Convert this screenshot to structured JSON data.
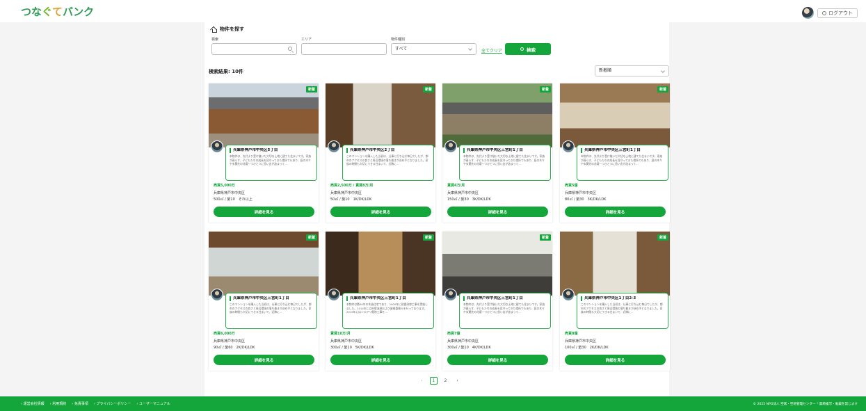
{
  "header": {
    "logo_chars": [
      "つ",
      "な",
      "ぐ",
      "て",
      "バ",
      "ン",
      "ク"
    ],
    "logo_colors": [
      "#2f9d55",
      "#2f9d55",
      "#74b72e",
      "#e0a43b",
      "#2f9d55",
      "#2f9d55",
      "#2f9d55"
    ],
    "logout_label": "ログアウト"
  },
  "search": {
    "title": "物件を探す",
    "keyword_label": "検索",
    "area_label": "エリア",
    "type_label": "物件種別",
    "type_value": "すべて",
    "clear_label": "全てクリア",
    "search_button": "検索"
  },
  "results": {
    "count_label": "検索結果: 10件",
    "sort_value": "新着順"
  },
  "cards": [
    {
      "badge": "新着",
      "address": "兵庫県神戸市中央区5丁目",
      "description": "本物件は、先代より受け継いだ大切な土地に建てた住まいです。家族が暮らす、子どもたちの成長を見守ってきた場所でもあり、庭の木々や玄関先の花壇一つひとつに思い出が詰まって…",
      "price": "売買5,000万",
      "location": "兵庫県神戸市中央区",
      "spec": "500㎡ / 築10　それ以上"
    },
    {
      "badge": "新着",
      "address": "兵庫県神戸市中央区2丁目",
      "description": "このマンションを購入した当初は、仕事に打ち込む毎日でしたが、都市のアクセスの良さと周辺環境の落ち着きが決め手となりました。家族の時間も大切にできる住まいで、近隣に…",
      "price": "売買2,500万 / 賃貸8万/月",
      "location": "兵庫県神戸市中央区",
      "spec": "50㎡ / 築10　1K/DK/LDK"
    },
    {
      "badge": "新着",
      "address": "兵庫県神戸市中央区三宮町1丁目",
      "description": "本物件は、先代より受け継いだ大切な土地に建てた住まいです。家族が暮らす、子どもたちの成長を見守ってきた場所でもあり、庭の木々や玄関先の花壇一つひとつに思い出が詰まって…",
      "price": "賃貸4万/月",
      "location": "兵庫県神戸市中央区",
      "spec": "150㎡ / 築30　3K/DK/LDK"
    },
    {
      "badge": "新着",
      "address": "兵庫県神戸市中央区三宮町1丁目",
      "description": "本物件は、先代より受け継いだ大切な土地に建てた住まいです。家族が暮らす、子どもたちの成長を見守ってきた場所でもあり、庭の木々や玄関先の花壇一つひとつに思い出が詰まって…",
      "price": "売買5億",
      "location": "兵庫県神戸市中央区",
      "spec": "80㎡ / 築30　3K/DK/LDK"
    },
    {
      "badge": "新着",
      "address": "兵庫県神戸市中央区三宮町1丁目",
      "description": "このマンションを購入した当初は、仕事に打ち込む毎日でしたが、都市のアクセスの良さと周辺環境の落ち着きが決め手となりました。家族の時間も大切にできる住まいで、近隣に…",
      "price": "売買6,000万",
      "location": "兵庫県神戸市中央区",
      "spec": "90㎡ / 築60　2K/DK/LDK"
    },
    {
      "badge": "新着",
      "address": "兵庫県神戸市中央区三宮町1丁目",
      "description": "本物件は築30年の木造住宅であり、2000年に耐震改修工事を実施しました。2014年には外壁塗装および屋根葺替えを行っております。2019年にはシロアリ駆除工事を…",
      "price": "賃貸10万/月",
      "location": "兵庫県神戸市中央区",
      "spec": "300㎡ / 築10　5K/DK/LDK"
    },
    {
      "badge": "新着",
      "address": "兵庫県神戸市中央区三宮町1丁目",
      "description": "本物件は、先代より受け継いだ大切な土地に建てた住まいです。家族が暮らす、子どもたちの成長を見守ってきた場所でもあり、庭の木々や玄関先の花壇一つひとつに思い出が詰まって…",
      "price": "売買7億",
      "location": "兵庫県神戸市中央区",
      "spec": "300㎡ / 築10　4K/DK/LDK"
    },
    {
      "badge": "新着",
      "address": "兵庫県神戸市中央区1丁目2-3",
      "description": "このマンションを購入した当初は、仕事に打ち込む毎日でしたが、都市のアクセスの良さと周辺環境の落ち着きが決め手となりました。家族の時間も大切にできる住まいで、近隣に…",
      "price": "売買8億",
      "location": "兵庫県神戸市中央区",
      "spec": "100㎡ / 築30　2K/DK/LDK"
    }
  ],
  "detail_button": "詳細を見る",
  "pagination": {
    "prev": "‹",
    "pages": [
      "1",
      "2"
    ],
    "next": "›"
  },
  "footer": {
    "links": [
      "運営会社情報",
      "利用規約",
      "免責事項",
      "プライバシーポリシー",
      "ユーザーマニュアル"
    ],
    "copyright": "© 2025 NPO法人 空家・空地管理センター * 無断複写・転載を禁じます"
  },
  "colors": {
    "brand_green": "#14a63b"
  }
}
